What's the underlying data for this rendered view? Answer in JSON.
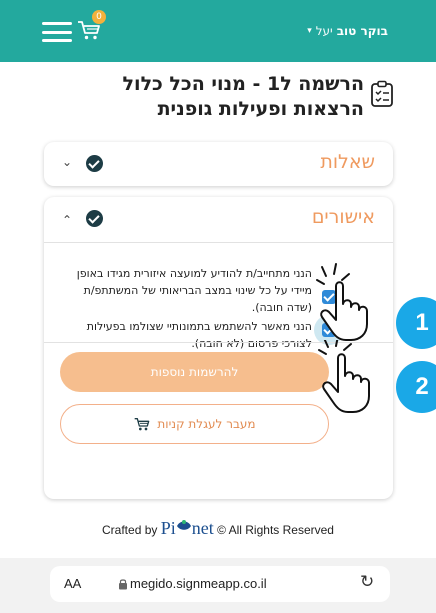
{
  "header": {
    "greeting": "בוקר טוב",
    "user_name": "יעל",
    "cart_count": "0",
    "colors": {
      "bar": "#23a99e",
      "badge": "#f3b13c"
    }
  },
  "page": {
    "title": "הרשמה ל1 - מנוי הכל כלול הרצאות ופעילות גופנית"
  },
  "sections": {
    "questions_label": "שאלות",
    "approvals_label": "אישורים"
  },
  "consents": [
    {
      "text": "הנני מתחייב/ת להודיע למועצה איזורית מגידו באופן מיידי על כל שינוי במצב הבריאותי של המשתתפ/ת (שדה חובה).",
      "checked": true
    },
    {
      "text": "הנני מאשר להשתמש בתמונותיי שצולמו בפעילות לצורכי פרסום (לא חובה).",
      "checked": true
    }
  ],
  "buttons": {
    "more_registrations": "להרשמות נוספות",
    "go_to_cart": "מעבר לעגלת קניות"
  },
  "callouts": {
    "one": "1",
    "two": "2"
  },
  "footer": {
    "crafted_by": "Crafted by",
    "brand_p": "Pi",
    "brand_rest": "net",
    "rights": "© All Rights Reserved"
  },
  "browser": {
    "text_size": "AA",
    "url": "megido.signmeapp.co.il"
  },
  "icons": [
    "hamburger-icon",
    "cart-icon",
    "chevron-down-icon",
    "clipboard-icon",
    "check-circle-icon",
    "chevron-up-icon",
    "checkbox-icon",
    "hand-pointer-icon",
    "lock-icon",
    "reload-icon"
  ]
}
